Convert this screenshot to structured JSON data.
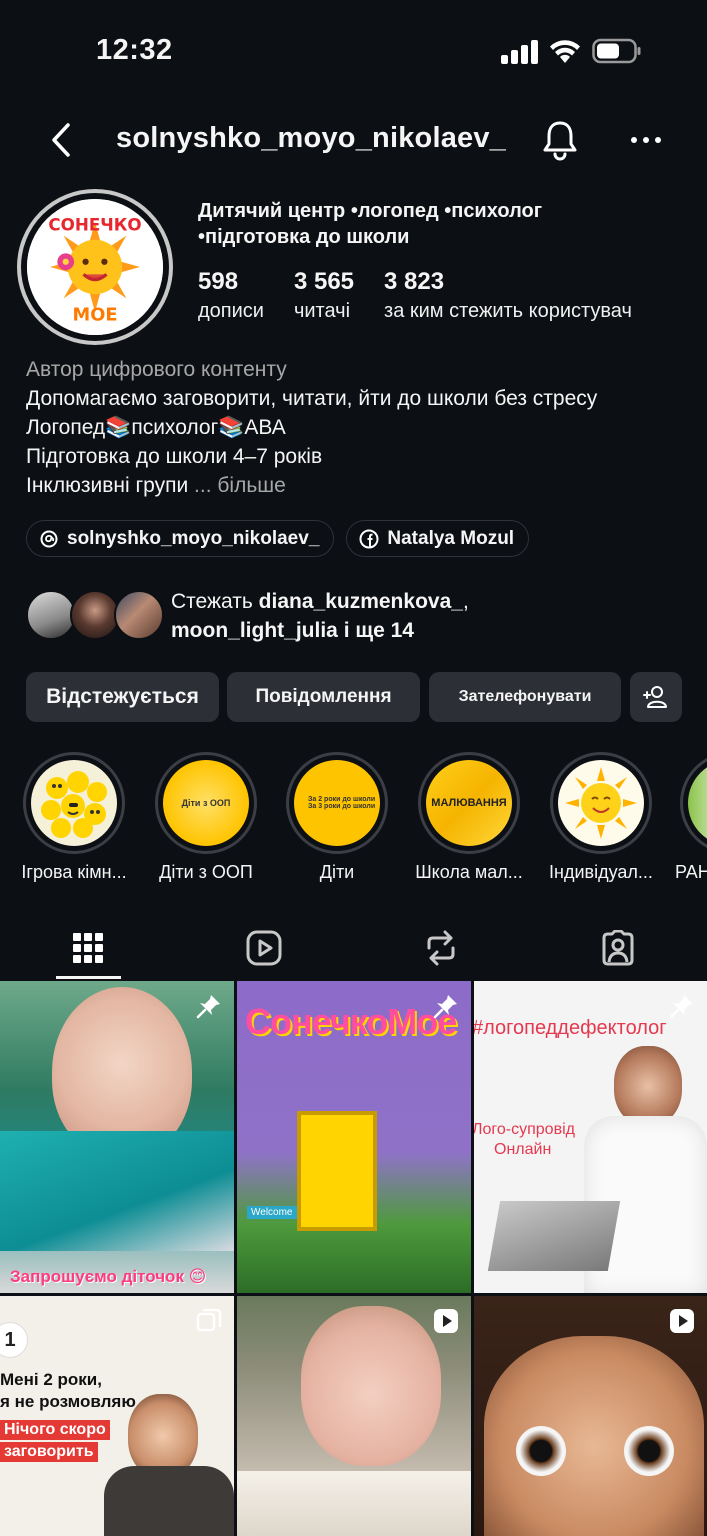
{
  "status_bar": {
    "time": "12:32"
  },
  "header": {
    "username": "solnyshko_moyo_nikolaev_"
  },
  "profile": {
    "category": "Дитячий центр •логопед •психолог •підготовка до школи",
    "logo_text_top": "СОНЕЧКО",
    "logo_text_bottom": "МОЕ",
    "stats": [
      {
        "value": "598",
        "label": "дописи"
      },
      {
        "value": "3 565",
        "label": "читачі"
      },
      {
        "value": "3 823",
        "label": "за ким стежить користувач"
      }
    ]
  },
  "bio": {
    "role": "Автор цифрового контенту",
    "line1": "Допомагаємо заговорити, читати, йти до школи без стресу",
    "line2": "Логопед📚психолог📚АВА",
    "line3": "Підготовка до школи 4–7 років",
    "line4": "Інклюзивні групи",
    "ellipsis": "...",
    "more": "більше"
  },
  "links": {
    "threads": "solnyshko_moyo_nikolaev_",
    "facebook": "Natalya  Mozul"
  },
  "followed_by": {
    "prefix": "Стежать",
    "user1": "diana_kuzmenkova_",
    "comma": ",",
    "user2": "moon_light_julia",
    "suffix": "і ще 14"
  },
  "actions": {
    "following": "Відстежується",
    "message": "Повідомлення",
    "call": "Зателефонувати"
  },
  "highlights": [
    {
      "label": "Ігрова кімн..."
    },
    {
      "label": "Діти  з ООП",
      "cover_text": "Діти з ООП"
    },
    {
      "label": "Діти",
      "cover_text1": "За 2 роки до школи",
      "cover_text2": "За 3 роки до школи"
    },
    {
      "label": "Школа мал...",
      "cover_text": "МАЛЮВАННЯ"
    },
    {
      "label": "Індивідуал..."
    },
    {
      "label": "РАН"
    }
  ],
  "posts": {
    "p1_caption": "Запрошуємо діточок 😊",
    "p2_title": "СонечкоМое",
    "p2_sign": "Welcome",
    "p3_hashtag": "#логопеддефектолог",
    "p3_line1": "Лого-супровід",
    "p3_line2": "Онлайн",
    "p4_num": "1",
    "p4_line1": "Мені 2 роки,",
    "p4_line2": "я не розмовляю",
    "p4_line3": "Нічого скоро",
    "p4_line4": "заговорить"
  },
  "colors": {
    "background": "#0c0f14",
    "button": "#2c2f35",
    "muted": "#a7a7a7",
    "accent_yellow": "#ffc400"
  }
}
